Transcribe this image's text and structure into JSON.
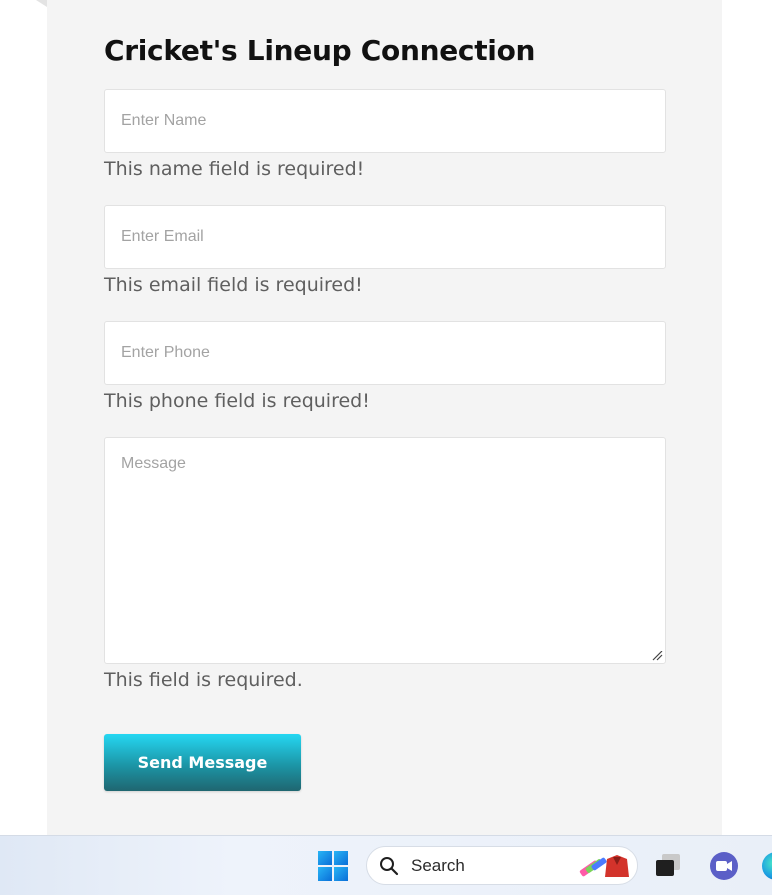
{
  "form": {
    "title": "Cricket's Lineup Connection",
    "name_placeholder": "Enter Name",
    "name_value": "",
    "name_error": "This name field is required!",
    "email_placeholder": "Enter Email",
    "email_value": "",
    "email_error": "This email field is required!",
    "phone_placeholder": "Enter Phone",
    "phone_value": "",
    "phone_error": "This phone field is required!",
    "message_placeholder": "Message",
    "message_value": "",
    "message_error": "This field is required.",
    "submit_label": "Send Message"
  },
  "taskbar": {
    "search_label": "Search",
    "icons": [
      "windows-start-icon",
      "search-icon",
      "task-view-icon",
      "meet-video-icon",
      "edge-browser-icon"
    ]
  },
  "colors": {
    "panel_background": "#f4f4f4",
    "button_gradient_top": "#25d7f2",
    "button_gradient_bottom": "#1f6670",
    "error_text": "#5f5f5f"
  }
}
